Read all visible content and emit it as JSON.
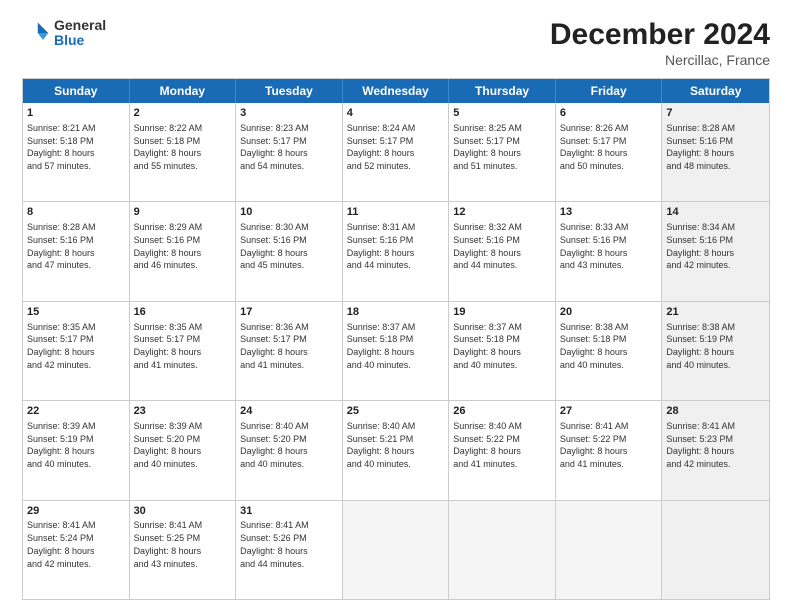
{
  "header": {
    "logo_general": "General",
    "logo_blue": "Blue",
    "title": "December 2024",
    "subtitle": "Nercillac, France"
  },
  "calendar": {
    "days_of_week": [
      "Sunday",
      "Monday",
      "Tuesday",
      "Wednesday",
      "Thursday",
      "Friday",
      "Saturday"
    ],
    "weeks": [
      [
        {
          "day": "",
          "empty": true
        },
        {
          "day": "",
          "empty": true
        },
        {
          "day": "",
          "empty": true
        },
        {
          "day": "",
          "empty": true
        },
        {
          "day": "",
          "empty": true
        },
        {
          "day": "",
          "empty": true
        },
        {
          "day": "",
          "empty": true
        }
      ]
    ],
    "cells": {
      "w1": [
        {
          "num": "1",
          "text": "Sunrise: 8:21 AM\nSunset: 5:18 PM\nDaylight: 8 hours\nand 57 minutes."
        },
        {
          "num": "2",
          "text": "Sunrise: 8:22 AM\nSunset: 5:18 PM\nDaylight: 8 hours\nand 55 minutes."
        },
        {
          "num": "3",
          "text": "Sunrise: 8:23 AM\nSunset: 5:17 PM\nDaylight: 8 hours\nand 54 minutes."
        },
        {
          "num": "4",
          "text": "Sunrise: 8:24 AM\nSunset: 5:17 PM\nDaylight: 8 hours\nand 52 minutes."
        },
        {
          "num": "5",
          "text": "Sunrise: 8:25 AM\nSunset: 5:17 PM\nDaylight: 8 hours\nand 51 minutes."
        },
        {
          "num": "6",
          "text": "Sunrise: 8:26 AM\nSunset: 5:17 PM\nDaylight: 8 hours\nand 50 minutes."
        },
        {
          "num": "7",
          "text": "Sunrise: 8:28 AM\nSunset: 5:16 PM\nDaylight: 8 hours\nand 48 minutes."
        }
      ],
      "w2": [
        {
          "num": "8",
          "text": "Sunrise: 8:28 AM\nSunset: 5:16 PM\nDaylight: 8 hours\nand 47 minutes."
        },
        {
          "num": "9",
          "text": "Sunrise: 8:29 AM\nSunset: 5:16 PM\nDaylight: 8 hours\nand 46 minutes."
        },
        {
          "num": "10",
          "text": "Sunrise: 8:30 AM\nSunset: 5:16 PM\nDaylight: 8 hours\nand 45 minutes."
        },
        {
          "num": "11",
          "text": "Sunrise: 8:31 AM\nSunset: 5:16 PM\nDaylight: 8 hours\nand 44 minutes."
        },
        {
          "num": "12",
          "text": "Sunrise: 8:32 AM\nSunset: 5:16 PM\nDaylight: 8 hours\nand 44 minutes."
        },
        {
          "num": "13",
          "text": "Sunrise: 8:33 AM\nSunset: 5:16 PM\nDaylight: 8 hours\nand 43 minutes."
        },
        {
          "num": "14",
          "text": "Sunrise: 8:34 AM\nSunset: 5:16 PM\nDaylight: 8 hours\nand 42 minutes."
        }
      ],
      "w3": [
        {
          "num": "15",
          "text": "Sunrise: 8:35 AM\nSunset: 5:17 PM\nDaylight: 8 hours\nand 42 minutes."
        },
        {
          "num": "16",
          "text": "Sunrise: 8:35 AM\nSunset: 5:17 PM\nDaylight: 8 hours\nand 41 minutes."
        },
        {
          "num": "17",
          "text": "Sunrise: 8:36 AM\nSunset: 5:17 PM\nDaylight: 8 hours\nand 41 minutes."
        },
        {
          "num": "18",
          "text": "Sunrise: 8:37 AM\nSunset: 5:18 PM\nDaylight: 8 hours\nand 40 minutes."
        },
        {
          "num": "19",
          "text": "Sunrise: 8:37 AM\nSunset: 5:18 PM\nDaylight: 8 hours\nand 40 minutes."
        },
        {
          "num": "20",
          "text": "Sunrise: 8:38 AM\nSunset: 5:18 PM\nDaylight: 8 hours\nand 40 minutes."
        },
        {
          "num": "21",
          "text": "Sunrise: 8:38 AM\nSunset: 5:19 PM\nDaylight: 8 hours\nand 40 minutes."
        }
      ],
      "w4": [
        {
          "num": "22",
          "text": "Sunrise: 8:39 AM\nSunset: 5:19 PM\nDaylight: 8 hours\nand 40 minutes."
        },
        {
          "num": "23",
          "text": "Sunrise: 8:39 AM\nSunset: 5:20 PM\nDaylight: 8 hours\nand 40 minutes."
        },
        {
          "num": "24",
          "text": "Sunrise: 8:40 AM\nSunset: 5:20 PM\nDaylight: 8 hours\nand 40 minutes."
        },
        {
          "num": "25",
          "text": "Sunrise: 8:40 AM\nSunset: 5:21 PM\nDaylight: 8 hours\nand 40 minutes."
        },
        {
          "num": "26",
          "text": "Sunrise: 8:40 AM\nSunset: 5:22 PM\nDaylight: 8 hours\nand 41 minutes."
        },
        {
          "num": "27",
          "text": "Sunrise: 8:41 AM\nSunset: 5:22 PM\nDaylight: 8 hours\nand 41 minutes."
        },
        {
          "num": "28",
          "text": "Sunrise: 8:41 AM\nSunset: 5:23 PM\nDaylight: 8 hours\nand 42 minutes."
        }
      ],
      "w5": [
        {
          "num": "29",
          "text": "Sunrise: 8:41 AM\nSunset: 5:24 PM\nDaylight: 8 hours\nand 42 minutes."
        },
        {
          "num": "30",
          "text": "Sunrise: 8:41 AM\nSunset: 5:25 PM\nDaylight: 8 hours\nand 43 minutes."
        },
        {
          "num": "31",
          "text": "Sunrise: 8:41 AM\nSunset: 5:26 PM\nDaylight: 8 hours\nand 44 minutes."
        },
        {
          "num": "",
          "empty": true
        },
        {
          "num": "",
          "empty": true
        },
        {
          "num": "",
          "empty": true
        },
        {
          "num": "",
          "empty": true
        }
      ]
    }
  }
}
